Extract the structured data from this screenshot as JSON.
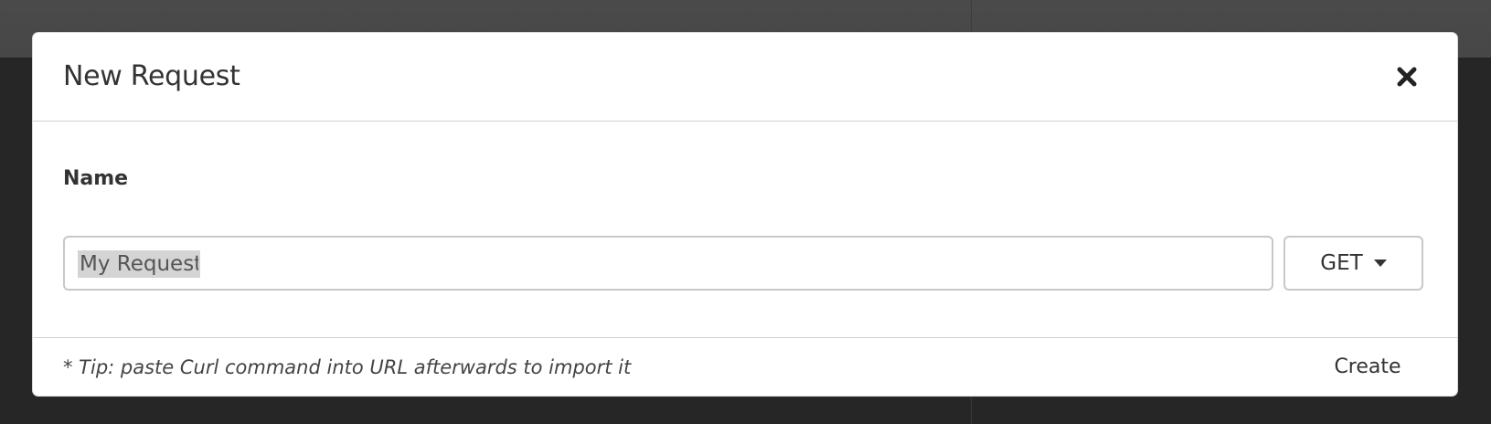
{
  "dialog": {
    "title": "New Request",
    "close_icon": "close-icon"
  },
  "form": {
    "name_label": "Name",
    "name_value": "My Request",
    "method": "GET",
    "method_icon": "caret-down-icon"
  },
  "footer": {
    "tip": "* Tip: paste Curl command into URL afterwards to import it",
    "create_label": "Create"
  },
  "colors": {
    "background": "#262626",
    "topbar": "#474747",
    "modal": "#ffffff",
    "text": "#333333",
    "selection": "#d4d4d4"
  }
}
